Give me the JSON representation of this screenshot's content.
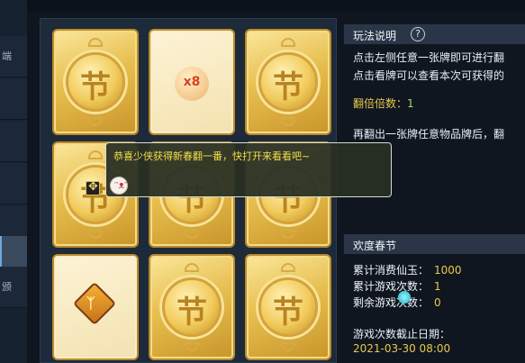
{
  "sidebar": {
    "items": [
      {
        "label": "端"
      },
      {
        "label": ""
      },
      {
        "label": ""
      },
      {
        "label": ""
      },
      {
        "label": ""
      },
      {
        "label": ""
      },
      {
        "label": "颁"
      }
    ]
  },
  "board": {
    "cards": [
      {
        "state": "hidden"
      },
      {
        "state": "revealed",
        "content": "x8"
      },
      {
        "state": "hidden"
      },
      {
        "state": "hidden"
      },
      {
        "state": "hidden"
      },
      {
        "state": "hidden"
      },
      {
        "state": "revealed",
        "content": "item"
      },
      {
        "state": "hidden"
      },
      {
        "state": "hidden"
      }
    ],
    "card_back_glyph": "节"
  },
  "popup": {
    "message": "恭喜少侠获得新春翻一番，快打开来看看吧~"
  },
  "rules": {
    "title": "玩法说明",
    "help_icon": "?",
    "line1": "点击左侧任意一张牌即可进行翻",
    "line2": "点击看牌可以查看本次可获得的",
    "multiplier_label": "翻倍倍数：",
    "multiplier_value": "1",
    "line3": "再翻出一张牌任意物品牌后，翻"
  },
  "event": {
    "title": "欢度春节",
    "stats": [
      {
        "label": "累计消费仙玉：",
        "value": "1000"
      },
      {
        "label": "累计游戏次数：",
        "value": "1"
      },
      {
        "label": "剩余游戏次数：",
        "value": "0"
      }
    ],
    "deadline_label": "游戏次数截止日期：",
    "deadline_value": "2021-03-30 08:00"
  },
  "colors": {
    "accent_gold": "#e9c94b",
    "green": "#9de070",
    "popup_text": "#f3df4a"
  }
}
